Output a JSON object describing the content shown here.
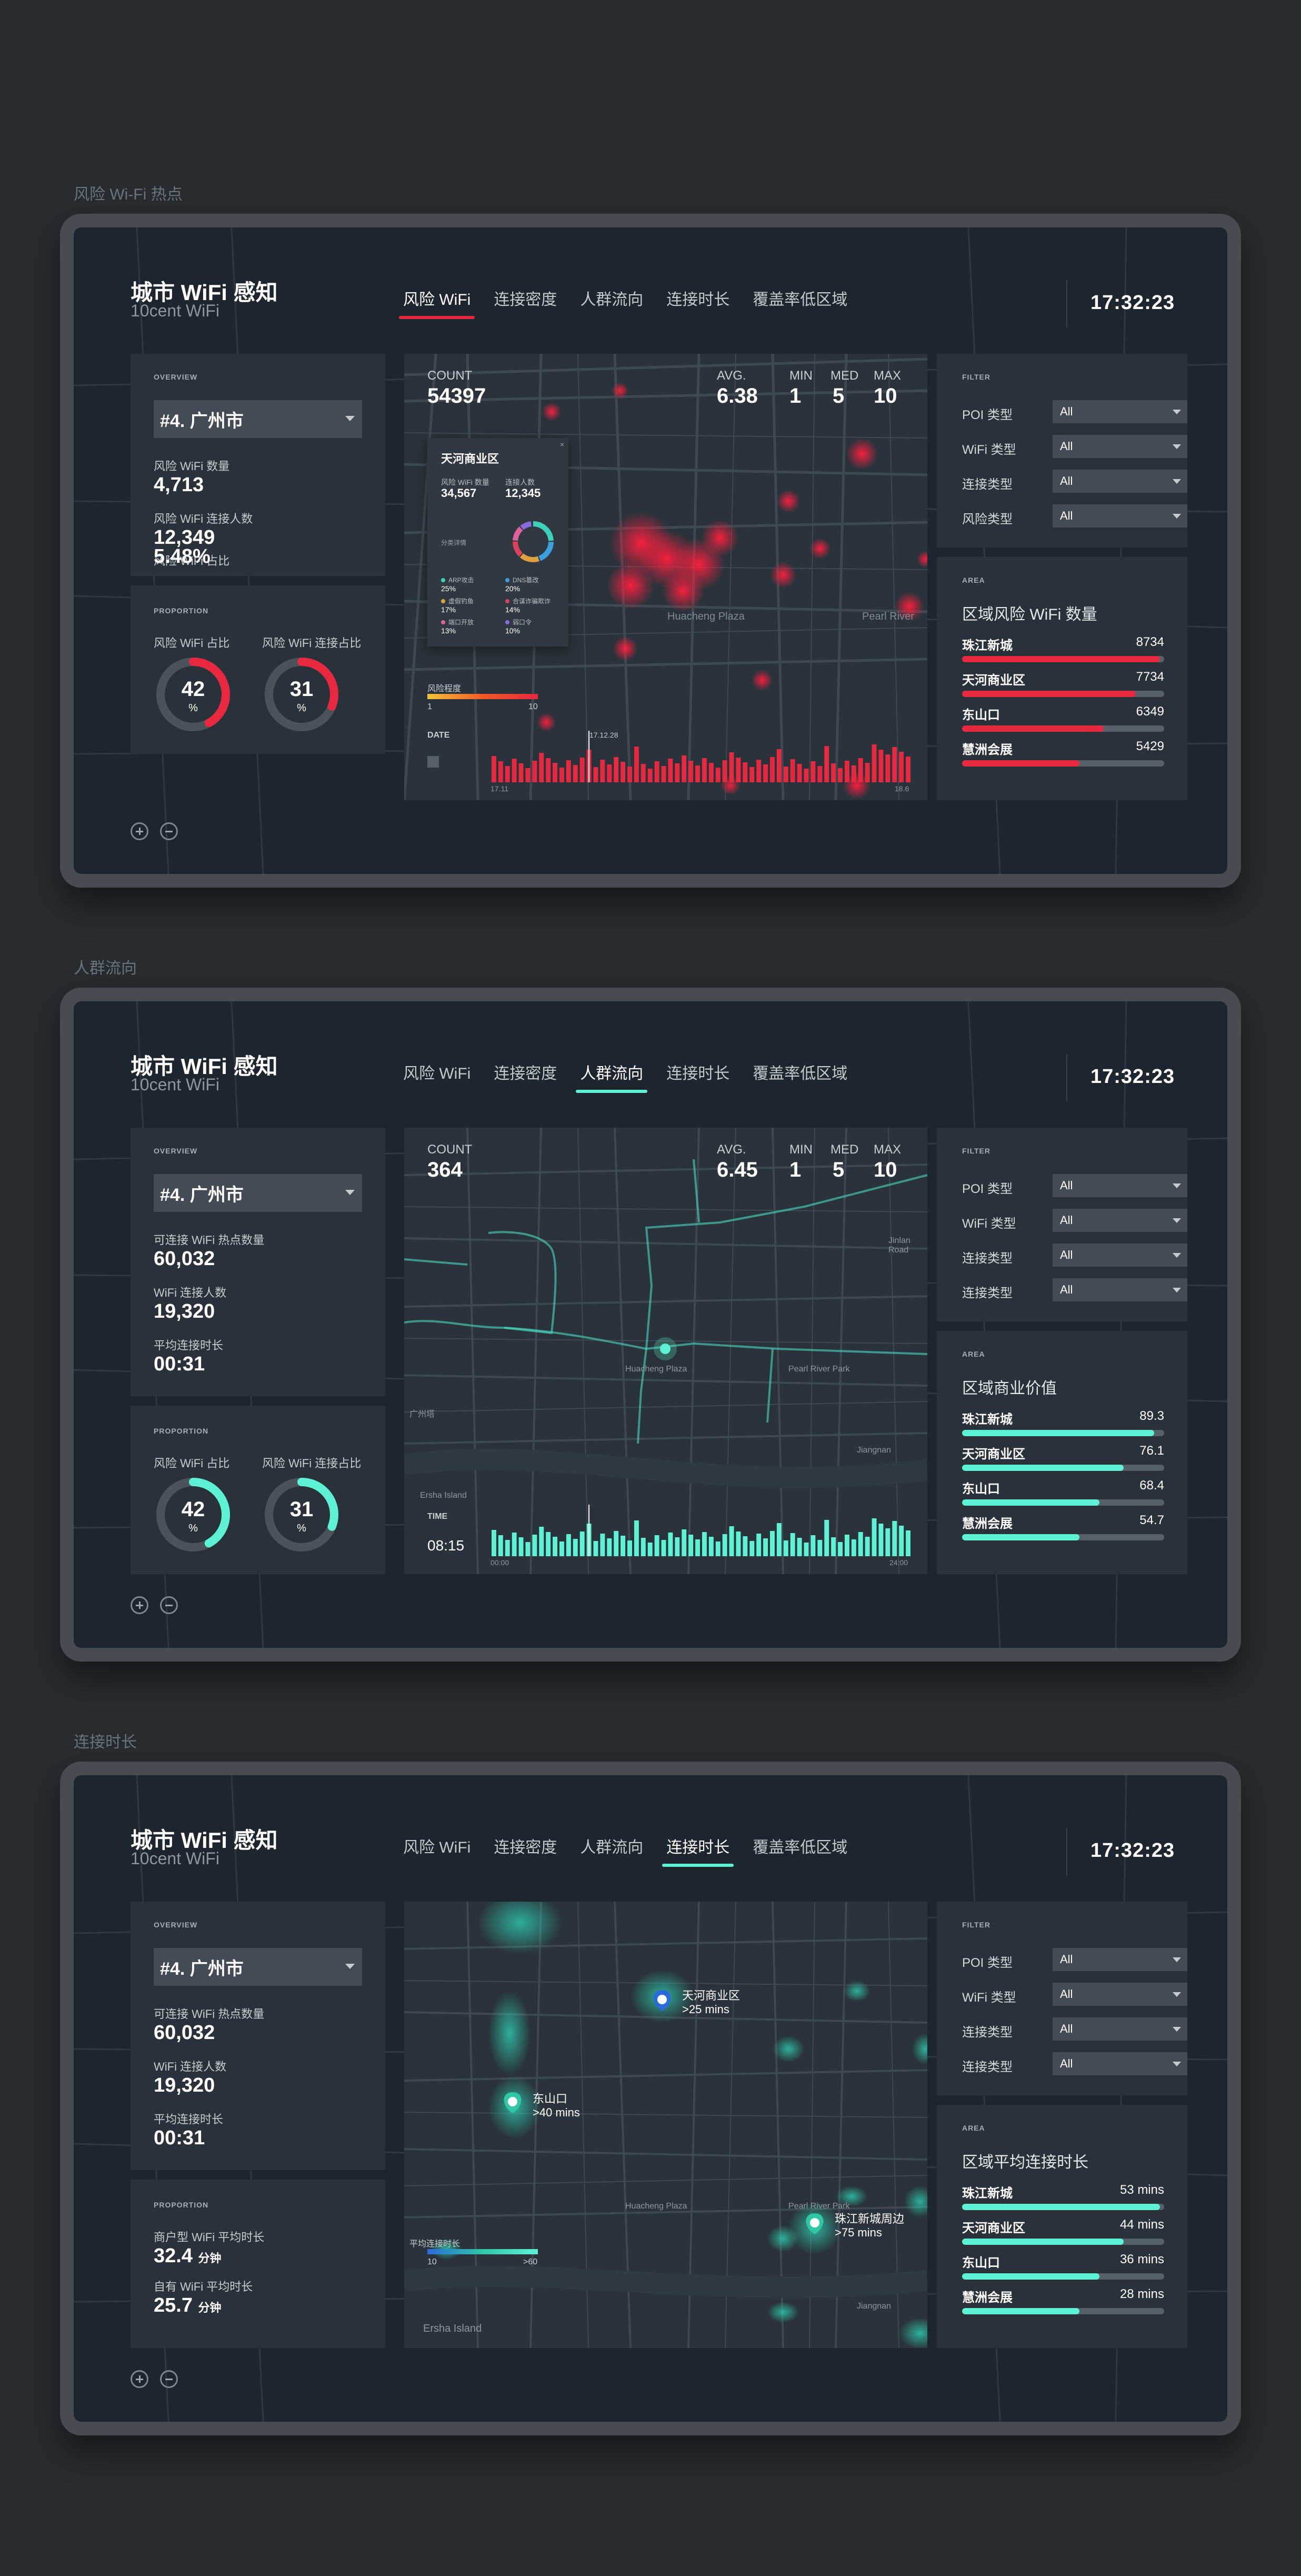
{
  "app": {
    "title": "城市 WiFi 感知",
    "subtitle": "10cent WiFi",
    "clock": "17:32:23"
  },
  "tabs": [
    "风险 WiFi",
    "连接密度",
    "人群流向",
    "连接时长",
    "覆盖率低区域"
  ],
  "labels": {
    "overview": "OVERVIEW",
    "proportion": "PROPORTION",
    "filter": "FILTER",
    "area": "AREA",
    "count": "COUNT",
    "avg": "AVG.",
    "min": "MIN",
    "med": "MED",
    "max": "MAX",
    "date": "DATE",
    "time": "TIME"
  },
  "filters": [
    {
      "label": "POI 类型",
      "value": "All"
    },
    {
      "label": "WiFi 类型",
      "value": "All"
    },
    {
      "label": "连接类型",
      "value": "All"
    }
  ],
  "s1": {
    "section": "风险 Wi-Fi 热点",
    "city": "#4. 广州市",
    "stats": [
      {
        "label": "风险 WiFi 数量",
        "value": "4,713"
      },
      {
        "label": "风险 WiFi 连接人数",
        "value": "12,349"
      },
      {
        "label": "风险 WiFi 占比",
        "value": "5.48%"
      }
    ],
    "donuts": [
      {
        "label": "风险 WiFi 占比",
        "value": "42",
        "unit": "%",
        "fraction": 0.42
      },
      {
        "label": "风险 WiFi 连接占比",
        "value": "31",
        "unit": "%",
        "fraction": 0.31
      }
    ],
    "count": "54397",
    "avg": "6.38",
    "min": "1",
    "med": "5",
    "max": "10",
    "popup": {
      "title": "天河商业区",
      "k1": "风险 WiFi 数量",
      "v1": "34,567",
      "k2": "连接人数",
      "v2": "12,345",
      "sub": "分类详情",
      "items": [
        {
          "name": "ARP攻击",
          "pct": "25%",
          "color": "#3fd0b8"
        },
        {
          "name": "DNS篡改",
          "pct": "20%",
          "color": "#3aa0e0"
        },
        {
          "name": "虚假钓鱼",
          "pct": "17%",
          "color": "#e0a040"
        },
        {
          "name": "合谋诈骗欺诈",
          "pct": "14%",
          "color": "#e04060"
        },
        {
          "name": "端口开放",
          "pct": "13%",
          "color": "#e060a0"
        },
        {
          "name": "弱口令",
          "pct": "10%",
          "color": "#8a6be0"
        }
      ],
      "ring": [
        0.25,
        0.2,
        0.17,
        0.14,
        0.13,
        0.1
      ]
    },
    "legend": {
      "title": "风险程度",
      "min": "1",
      "max": "10"
    },
    "timeline": {
      "marker": "17.12.28",
      "start": "17.11",
      "end": "18.6"
    },
    "map_labels": [
      "Huacheng Plaza",
      "Pearl River"
    ],
    "filter4": {
      "label": "风险类型",
      "value": "All"
    },
    "area": {
      "title": "区域风险 WiFi 数量",
      "color": "#e8283f",
      "rows": [
        {
          "name": "珠江新城",
          "value": "8734",
          "fraction": 0.98
        },
        {
          "name": "天河商业区",
          "value": "7734",
          "fraction": 0.86
        },
        {
          "name": "东山口",
          "value": "6349",
          "fraction": 0.7
        },
        {
          "name": "慧洲会展",
          "value": "5429",
          "fraction": 0.58
        }
      ]
    }
  },
  "s2": {
    "section": "人群流向",
    "city": "#4. 广州市",
    "stats": [
      {
        "label": "可连接 WiFi 热点数量",
        "value": "60,032"
      },
      {
        "label": "WiFi 连接人数",
        "value": "19,320"
      },
      {
        "label": "平均连接时长",
        "value": "00:31"
      }
    ],
    "donuts": [
      {
        "label": "风险 WiFi 占比",
        "value": "42",
        "unit": "%",
        "fraction": 0.42
      },
      {
        "label": "风险 WiFi 连接占比",
        "value": "31",
        "unit": "%",
        "fraction": 0.31
      }
    ],
    "count": "364",
    "avg": "6.45",
    "min": "1",
    "med": "5",
    "max": "10",
    "time_value": "08:15",
    "timeline": {
      "start": "00:00",
      "end": "24:00"
    },
    "map_labels": [
      "Huacheng Plaza",
      "Pearl River Park",
      "广州塔",
      "Ersha Island",
      "Jiangnan",
      "Jinlan Road"
    ],
    "filter4": {
      "label": "连接类型",
      "value": "All"
    },
    "area": {
      "title": "区域商业价值",
      "color": "#5ef2d4",
      "rows": [
        {
          "name": "珠江新城",
          "value": "89.3",
          "fraction": 0.95
        },
        {
          "name": "天河商业区",
          "value": "76.1",
          "fraction": 0.8
        },
        {
          "name": "东山口",
          "value": "68.4",
          "fraction": 0.68
        },
        {
          "name": "慧洲会展",
          "value": "54.7",
          "fraction": 0.58
        }
      ]
    }
  },
  "s3": {
    "section": "连接时长",
    "city": "#4. 广州市",
    "stats": [
      {
        "label": "可连接 WiFi 热点数量",
        "value": "60,032"
      },
      {
        "label": "WiFi 连接人数",
        "value": "19,320"
      },
      {
        "label": "平均连接时长",
        "value": "00:31"
      }
    ],
    "prop": [
      {
        "label": "商户型 WiFi 平均时长",
        "value": "32.4",
        "unit": "分钟"
      },
      {
        "label": "自有 WiFi 平均时长",
        "value": "25.7",
        "unit": "分钟"
      }
    ],
    "pins": [
      {
        "name": "天河商业区",
        "value": ">25 mins"
      },
      {
        "name": "东山口",
        "value": ">40 mins"
      },
      {
        "name": "珠江新城周边",
        "value": ">75 mins"
      }
    ],
    "legend": {
      "title": "平均连接时长",
      "min": "10",
      "max": ">60"
    },
    "map_labels": [
      "Huacheng Plaza",
      "Pearl River Park",
      "Ersha Island",
      "Jiangnan"
    ],
    "filter4": {
      "label": "连接类型",
      "value": "All"
    },
    "area": {
      "title": "区域平均连接时长",
      "color": "#5ef2d4",
      "rows": [
        {
          "name": "珠江新城",
          "value": "53 mins",
          "fraction": 0.98
        },
        {
          "name": "天河商业区",
          "value": "44 mins",
          "fraction": 0.8
        },
        {
          "name": "东山口",
          "value": "36 mins",
          "fraction": 0.68
        },
        {
          "name": "慧洲会展",
          "value": "28 mins",
          "fraction": 0.58
        }
      ]
    }
  },
  "colors": {
    "red": "#e8283f",
    "teal": "#5ef2d4",
    "bg": "#1d262e",
    "panel": "#29323a"
  }
}
